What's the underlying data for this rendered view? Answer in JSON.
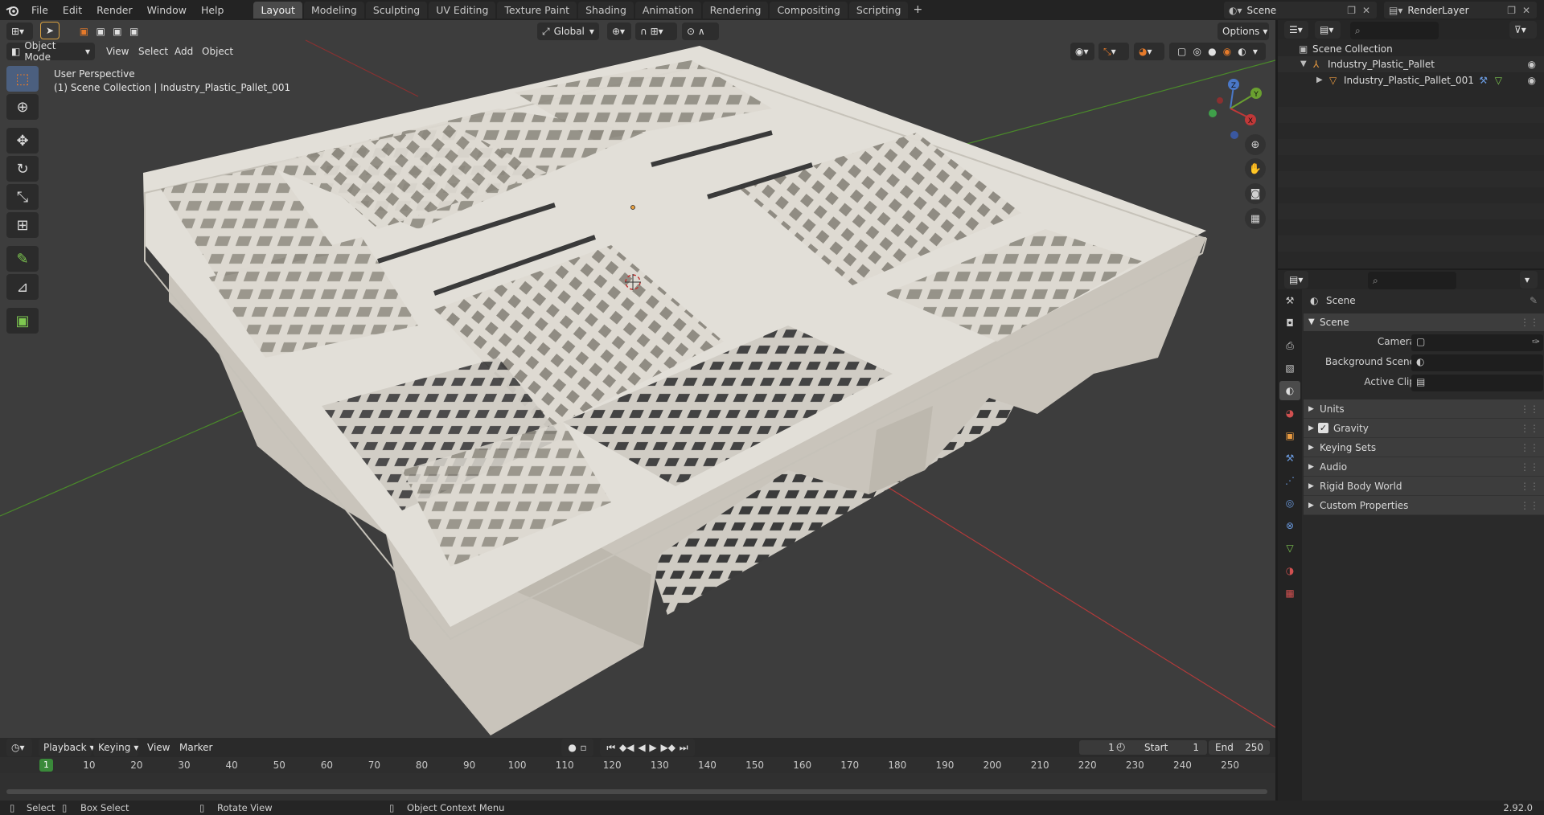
{
  "topbar": {
    "menus": [
      "File",
      "Edit",
      "Render",
      "Window",
      "Help"
    ],
    "workspaces": [
      "Layout",
      "Modeling",
      "Sculpting",
      "UV Editing",
      "Texture Paint",
      "Shading",
      "Animation",
      "Rendering",
      "Compositing",
      "Scripting"
    ],
    "active_workspace": "Layout",
    "scene_name": "Scene",
    "view_layer": "RenderLayer"
  },
  "viewport": {
    "mode": "Object Mode",
    "menus": [
      "View",
      "Select",
      "Add",
      "Object"
    ],
    "transform_orientation": "Global",
    "options_label": "Options",
    "view_name": "User Perspective",
    "collection_info": "(1) Scene Collection | Industry_Plastic_Pallet_001",
    "gizmo_axes": {
      "z": "Z",
      "y": "Y",
      "x": "X"
    }
  },
  "timeline": {
    "menus": [
      "Playback",
      "Keying",
      "View",
      "Marker"
    ],
    "current_frame": "1",
    "start_label": "Start",
    "start_value": "1",
    "end_label": "End",
    "end_value": "250",
    "ruler": [
      "10",
      "20",
      "30",
      "40",
      "50",
      "60",
      "70",
      "80",
      "90",
      "100",
      "110",
      "120",
      "130",
      "140",
      "150",
      "160",
      "170",
      "180",
      "190",
      "200",
      "210",
      "220",
      "230",
      "240",
      "250"
    ],
    "ruler_current": "1"
  },
  "statusbar": {
    "select": "Select",
    "box_select": "Box Select",
    "rotate": "Rotate View",
    "context_menu": "Object Context Menu",
    "version": "2.92.0"
  },
  "outliner": {
    "root": "Scene Collection",
    "items": [
      {
        "name": "Industry_Plastic_Pallet"
      },
      {
        "name": "Industry_Plastic_Pallet_001"
      }
    ]
  },
  "properties": {
    "context": "Scene",
    "panel": "Scene",
    "fields": [
      {
        "label": "Camera"
      },
      {
        "label": "Background Scene"
      },
      {
        "label": "Active Clip"
      }
    ],
    "subpanels": [
      "Units",
      "Gravity",
      "Keying Sets",
      "Audio",
      "Rigid Body World",
      "Custom Properties"
    ]
  },
  "colors": {
    "accent_blue": "#4b5f7f",
    "frame_green": "#3a8a3a",
    "axis_red": "#b23a3a",
    "axis_green": "#4a8a2a"
  }
}
